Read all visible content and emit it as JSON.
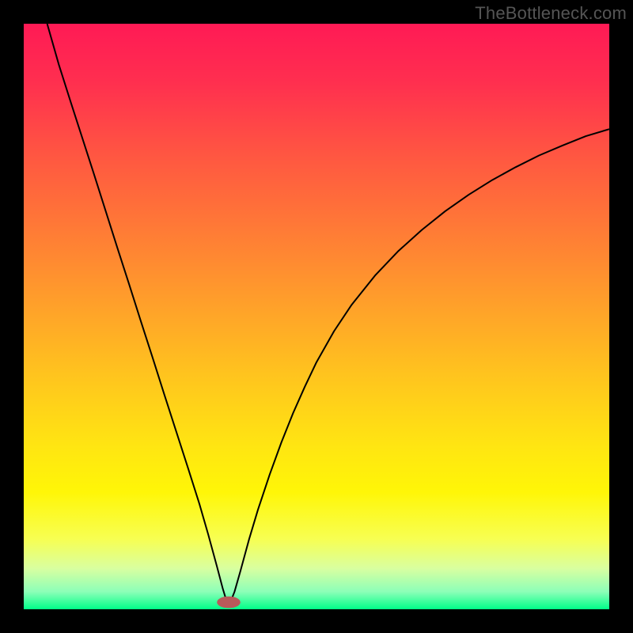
{
  "watermark": "TheBottleneck.com",
  "chart_data": {
    "type": "line",
    "title": "",
    "xlabel": "",
    "ylabel": "",
    "xlim": [
      0,
      100
    ],
    "ylim": [
      0,
      100
    ],
    "background": {
      "type": "vertical-gradient",
      "stops": [
        {
          "offset": 0.0,
          "color": "#ff1a55"
        },
        {
          "offset": 0.1,
          "color": "#ff2f4f"
        },
        {
          "offset": 0.22,
          "color": "#ff5542"
        },
        {
          "offset": 0.35,
          "color": "#ff7a36"
        },
        {
          "offset": 0.48,
          "color": "#ffa02a"
        },
        {
          "offset": 0.6,
          "color": "#ffc41e"
        },
        {
          "offset": 0.72,
          "color": "#ffe512"
        },
        {
          "offset": 0.8,
          "color": "#fff607"
        },
        {
          "offset": 0.88,
          "color": "#f7ff52"
        },
        {
          "offset": 0.93,
          "color": "#d9ffa0"
        },
        {
          "offset": 0.97,
          "color": "#8cffb8"
        },
        {
          "offset": 1.0,
          "color": "#00ff88"
        }
      ]
    },
    "marker": {
      "x": 35,
      "y": 1.2,
      "rx": 2.0,
      "ry": 1.0,
      "color": "#b85a5a"
    },
    "series": [
      {
        "name": "bottleneck-curve",
        "color": "#000000",
        "width": 2,
        "points": [
          {
            "x": 4.0,
            "y": 100.0
          },
          {
            "x": 6.0,
            "y": 93.0
          },
          {
            "x": 8.0,
            "y": 86.7
          },
          {
            "x": 10.0,
            "y": 80.5
          },
          {
            "x": 12.0,
            "y": 74.3
          },
          {
            "x": 14.0,
            "y": 68.0
          },
          {
            "x": 16.0,
            "y": 61.7
          },
          {
            "x": 18.0,
            "y": 55.5
          },
          {
            "x": 20.0,
            "y": 49.2
          },
          {
            "x": 22.0,
            "y": 43.0
          },
          {
            "x": 24.0,
            "y": 36.7
          },
          {
            "x": 26.0,
            "y": 30.5
          },
          {
            "x": 28.0,
            "y": 24.3
          },
          {
            "x": 30.0,
            "y": 18.0
          },
          {
            "x": 31.5,
            "y": 12.8
          },
          {
            "x": 33.0,
            "y": 7.3
          },
          {
            "x": 34.0,
            "y": 3.5
          },
          {
            "x": 34.7,
            "y": 1.2
          },
          {
            "x": 35.3,
            "y": 1.2
          },
          {
            "x": 36.0,
            "y": 3.0
          },
          {
            "x": 37.0,
            "y": 6.5
          },
          {
            "x": 38.5,
            "y": 12.0
          },
          {
            "x": 40.0,
            "y": 17.0
          },
          {
            "x": 42.0,
            "y": 23.0
          },
          {
            "x": 44.0,
            "y": 28.5
          },
          {
            "x": 46.0,
            "y": 33.5
          },
          {
            "x": 48.0,
            "y": 38.0
          },
          {
            "x": 50.0,
            "y": 42.2
          },
          {
            "x": 53.0,
            "y": 47.5
          },
          {
            "x": 56.0,
            "y": 52.0
          },
          {
            "x": 60.0,
            "y": 57.0
          },
          {
            "x": 64.0,
            "y": 61.2
          },
          {
            "x": 68.0,
            "y": 64.8
          },
          {
            "x": 72.0,
            "y": 68.0
          },
          {
            "x": 76.0,
            "y": 70.8
          },
          {
            "x": 80.0,
            "y": 73.3
          },
          {
            "x": 84.0,
            "y": 75.5
          },
          {
            "x": 88.0,
            "y": 77.5
          },
          {
            "x": 92.0,
            "y": 79.2
          },
          {
            "x": 96.0,
            "y": 80.8
          },
          {
            "x": 100.0,
            "y": 82.0
          }
        ]
      }
    ]
  }
}
